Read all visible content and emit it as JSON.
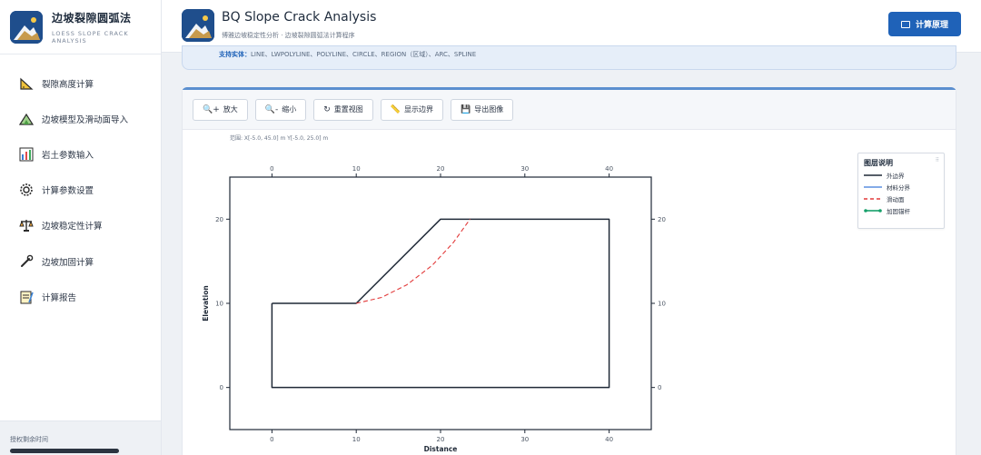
{
  "brand": {
    "title": "边坡裂隙圆弧法",
    "subtitle": "LOESS SLOPE CRACK ANALYSIS"
  },
  "sidebar": {
    "items": [
      {
        "label": "裂隙高度计算",
        "icon": "triangle-ruler-icon"
      },
      {
        "label": "边坡模型及滑动面导入",
        "icon": "slope-triangle-icon"
      },
      {
        "label": "岩土参数输入",
        "icon": "bar-chart-icon"
      },
      {
        "label": "计算参数设置",
        "icon": "gear-icon"
      },
      {
        "label": "边坡稳定性计算",
        "icon": "scale-icon"
      },
      {
        "label": "边坡加固计算",
        "icon": "wrench-icon"
      },
      {
        "label": "计算报告",
        "icon": "report-icon"
      }
    ],
    "footer_label": "授权剩余时间"
  },
  "header": {
    "title": "BQ Slope Crack Analysis",
    "subtitle": "博雅边坡稳定性分析 · 边坡裂隙圆弧法计算程序",
    "calc_button": "计算原理"
  },
  "info": {
    "label": "支持实体：",
    "text": "LINE、LWPOLYLINE、POLYLINE、CIRCLE、REGION（区域）、ARC、SPLINE"
  },
  "toolbar": {
    "zoom_in": "放大",
    "zoom_out": "缩小",
    "reset_view": "重置视图",
    "show_boundary": "显示边界",
    "export_image": "导出图像"
  },
  "plot": {
    "range_text": "范围: X[-5.0, 45.0] m  Y[-5.0, 25.0] m"
  },
  "legend": {
    "title": "图层说明",
    "items": [
      {
        "label": "外边界",
        "color": "#1f2937",
        "style": "solid"
      },
      {
        "label": "材料分界",
        "color": "#5b8fe0",
        "style": "solid"
      },
      {
        "label": "滑动面",
        "color": "#e23a3a",
        "style": "dashed"
      },
      {
        "label": "加固锚杆",
        "color": "#16a06a",
        "style": "solid-dots"
      }
    ]
  },
  "chart_data": {
    "type": "line",
    "xlabel": "Distance",
    "ylabel": "Elevation",
    "xlim": [
      -5,
      45
    ],
    "ylim": [
      -5,
      25
    ],
    "xticks": [
      0,
      10,
      20,
      30,
      40
    ],
    "yticks": [
      0,
      10,
      20
    ],
    "grid": false,
    "series": [
      {
        "name": "外边界",
        "color": "#1f2937",
        "style": "solid",
        "x": [
          0,
          10,
          20,
          40,
          40,
          0,
          0
        ],
        "y": [
          10,
          10,
          20,
          20,
          0,
          0,
          10
        ]
      },
      {
        "name": "滑动面",
        "color": "#e23a3a",
        "style": "dashed",
        "x": [
          10,
          13,
          16,
          19,
          21.5,
          23.5
        ],
        "y": [
          10,
          10.7,
          12.2,
          14.5,
          17.2,
          20
        ]
      }
    ]
  }
}
